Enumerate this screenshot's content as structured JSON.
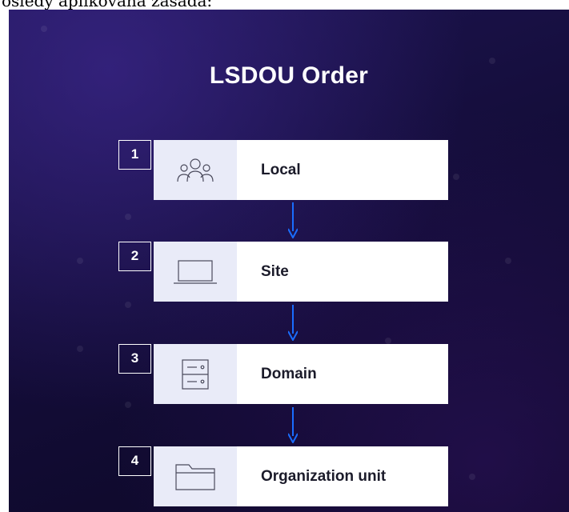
{
  "page": {
    "top_caption": "osledy aplikovaná zásada:"
  },
  "diagram": {
    "title": "LSDOU Order",
    "steps": [
      {
        "number": "1",
        "label": "Local",
        "icon": "users-group-icon"
      },
      {
        "number": "2",
        "label": "Site",
        "icon": "laptop-icon"
      },
      {
        "number": "3",
        "label": "Domain",
        "icon": "server-icon"
      },
      {
        "number": "4",
        "label": "Organization unit",
        "icon": "folder-icon"
      }
    ]
  },
  "colors": {
    "background": "#140d3a",
    "card": "#ffffff",
    "icon_cell": "#e9ebf8",
    "arrow": "#1a6dff",
    "text_dark": "#1b1b2a"
  }
}
